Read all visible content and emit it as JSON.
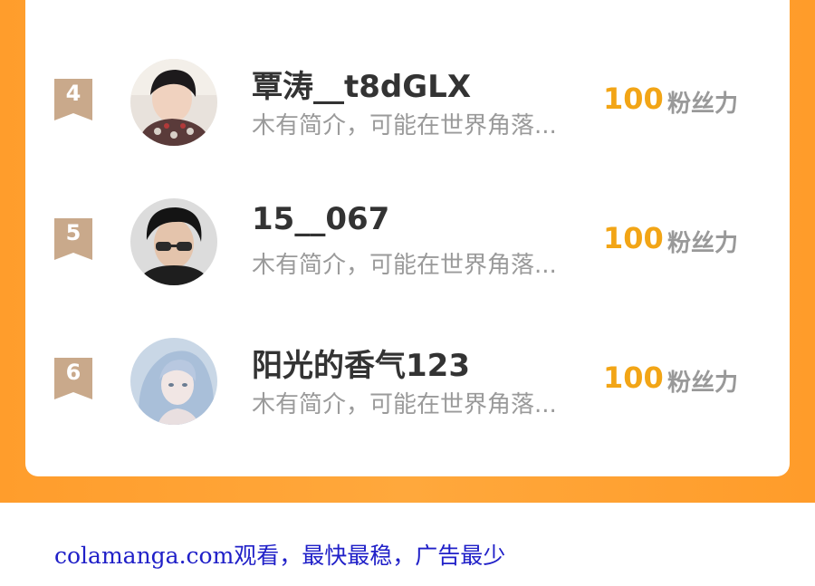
{
  "ranking": {
    "rows": [
      {
        "rank": "4",
        "name": "覃涛__t8dGLX",
        "bio": "木有简介，可能在世界角落...",
        "score": "100",
        "score_label": "粉丝力",
        "avatar_icon": "user-avatar-icon"
      },
      {
        "rank": "5",
        "name": "15__067",
        "bio": "木有简介，可能在世界角落...",
        "score": "100",
        "score_label": "粉丝力",
        "avatar_icon": "user-avatar-icon"
      },
      {
        "rank": "6",
        "name": "阳光的香气123",
        "bio": "木有简介，可能在世界角落...",
        "score": "100",
        "score_label": "粉丝力",
        "avatar_icon": "user-avatar-icon"
      }
    ]
  },
  "footer": {
    "text": "colamanga.com观看，最快最稳，广告最少"
  },
  "colors": {
    "accent_orange": "#ffa83c",
    "score_gold": "#f2a516",
    "badge_tan": "#c9a98b",
    "footer_link_blue": "#2020c8"
  }
}
